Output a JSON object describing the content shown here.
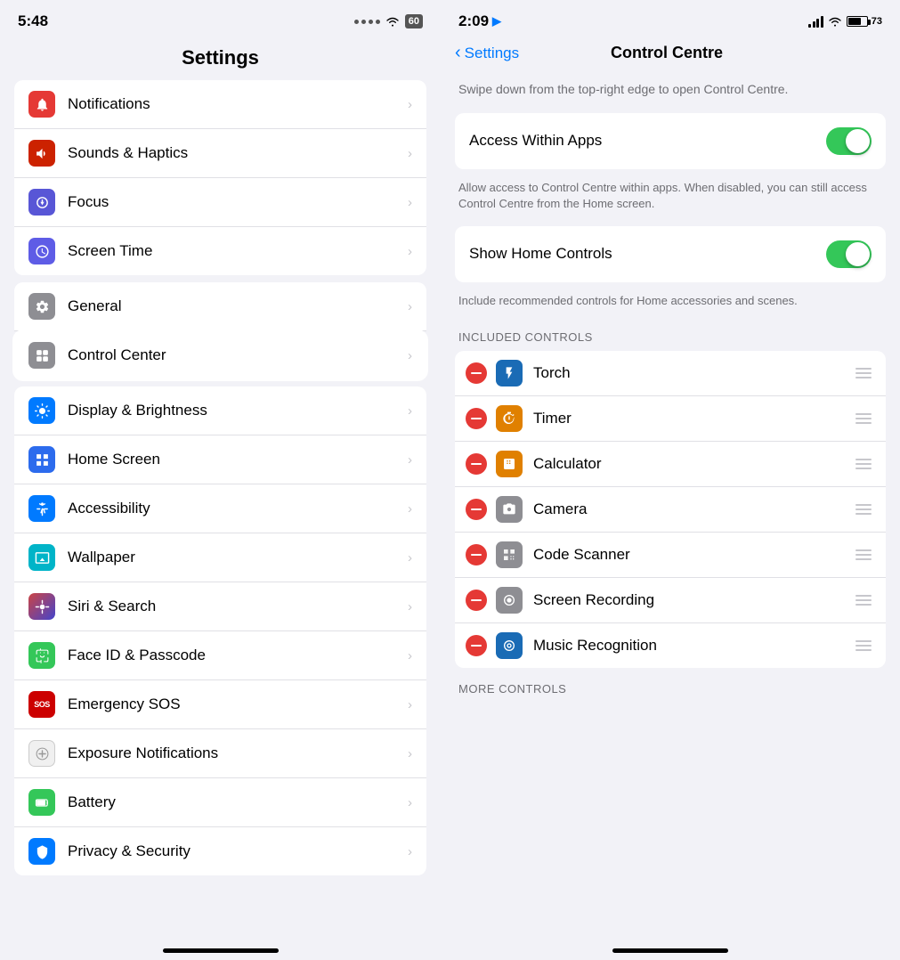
{
  "left": {
    "status": {
      "time": "5:48"
    },
    "title": "Settings",
    "items_group1": [
      {
        "id": "notifications",
        "label": "Notifications",
        "icon_color": "ic-red",
        "icon_char": "🔔"
      },
      {
        "id": "sounds",
        "label": "Sounds & Haptics",
        "icon_color": "ic-red2",
        "icon_char": "🔊"
      },
      {
        "id": "focus",
        "label": "Focus",
        "icon_color": "ic-purple",
        "icon_char": "🌙"
      },
      {
        "id": "screentime",
        "label": "Screen Time",
        "icon_color": "ic-blue-purple",
        "icon_char": "⏱"
      }
    ],
    "items_group2": [
      {
        "id": "general",
        "label": "General",
        "icon_color": "ic-gray",
        "icon_char": "⚙"
      },
      {
        "id": "controlcenter",
        "label": "Control Center",
        "icon_color": "ic-gray",
        "icon_char": "⊞",
        "highlighted": true
      }
    ],
    "items_group3": [
      {
        "id": "display",
        "label": "Display & Brightness",
        "icon_color": "ic-blue",
        "icon_char": "☀"
      },
      {
        "id": "homescreen",
        "label": "Home Screen",
        "icon_color": "ic-blue",
        "icon_char": "⊞"
      },
      {
        "id": "accessibility",
        "label": "Accessibility",
        "icon_color": "ic-blue",
        "icon_char": "♿"
      },
      {
        "id": "wallpaper",
        "label": "Wallpaper",
        "icon_color": "ic-teal2",
        "icon_char": "🖼"
      },
      {
        "id": "siri",
        "label": "Siri & Search",
        "icon_color": "ic-dark-gray",
        "icon_char": "◎"
      },
      {
        "id": "faceid",
        "label": "Face ID & Passcode",
        "icon_color": "ic-green",
        "icon_char": "👤"
      },
      {
        "id": "sos",
        "label": "Emergency SOS",
        "icon_color": "ic-sos",
        "icon_char": "SOS"
      },
      {
        "id": "exposure",
        "label": "Exposure Notifications",
        "icon_color": "ic-exposure",
        "icon_char": "✳"
      },
      {
        "id": "battery",
        "label": "Battery",
        "icon_color": "ic-green",
        "icon_char": "🔋"
      },
      {
        "id": "privacy",
        "label": "Privacy & Security",
        "icon_color": "ic-blue",
        "icon_char": "✋"
      }
    ]
  },
  "right": {
    "status": {
      "time": "2:09"
    },
    "back_label": "Settings",
    "title": "Control Centre",
    "description": "Swipe down from the top-right edge to open Control Centre.",
    "access_within_apps": {
      "label": "Access Within Apps",
      "enabled": true,
      "description": "Allow access to Control Centre within apps. When disabled, you can still access Control Centre from the Home screen."
    },
    "show_home_controls": {
      "label": "Show Home Controls",
      "enabled": true,
      "description": "Include recommended controls for Home accessories and scenes."
    },
    "included_controls_header": "INCLUDED CONTROLS",
    "controls": [
      {
        "id": "torch",
        "name": "Torch",
        "icon_color": "#1a6bb5"
      },
      {
        "id": "timer",
        "name": "Timer",
        "icon_color": "#e08000"
      },
      {
        "id": "calculator",
        "name": "Calculator",
        "icon_color": "#e08000"
      },
      {
        "id": "camera",
        "name": "Camera",
        "icon_color": "#8e8e93"
      },
      {
        "id": "code-scanner",
        "name": "Code Scanner",
        "icon_color": "#8e8e93"
      },
      {
        "id": "screen-recording",
        "name": "Screen Recording",
        "icon_color": "#8e8e93"
      },
      {
        "id": "music-recognition",
        "name": "Music Recognition",
        "icon_color": "#1a6bb5"
      }
    ],
    "more_controls_header": "MORE CONTROLS"
  }
}
